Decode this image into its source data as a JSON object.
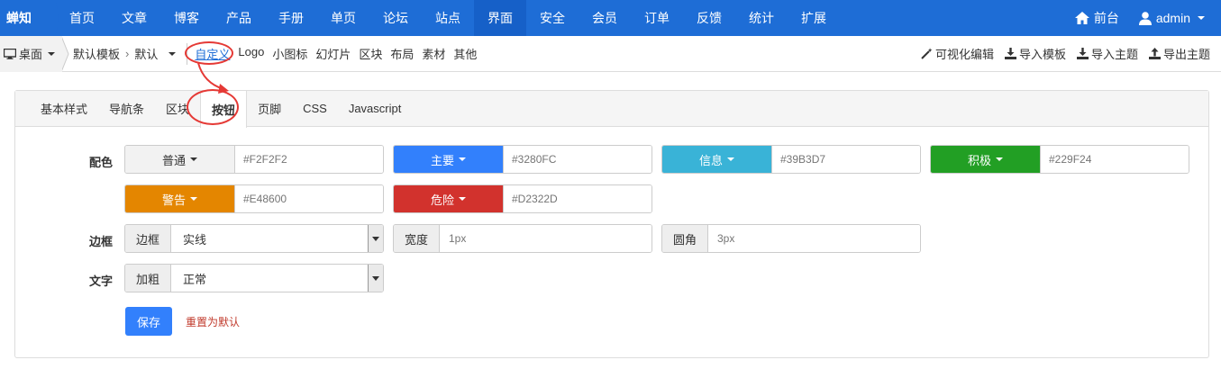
{
  "topnav": {
    "brand": "蝉知",
    "items": [
      "首页",
      "文章",
      "博客",
      "产品",
      "手册",
      "单页",
      "论坛",
      "站点",
      "界面",
      "安全",
      "会员",
      "订单",
      "反馈",
      "统计",
      "扩展"
    ],
    "active": "界面",
    "home": "前台",
    "user": "admin"
  },
  "subbar": {
    "desktop": "桌面",
    "crumb1": "默认模板",
    "crumb2": "默认",
    "links": [
      "自定义",
      "Logo",
      "小图标",
      "幻灯片",
      "区块",
      "布局",
      "素材",
      "其他"
    ],
    "active_link": "自定义",
    "right": [
      "可视化编辑",
      "导入模板",
      "导入主题",
      "导出主题"
    ]
  },
  "tabs": [
    "基本样式",
    "导航条",
    "区块",
    "按钮",
    "页脚",
    "CSS",
    "Javascript"
  ],
  "active_tab": "按钮",
  "form": {
    "color_label": "配色",
    "colors": [
      {
        "name": "普通",
        "placeholder": "#F2F2F2",
        "bg": "#f2f2f2",
        "fg": "#333333"
      },
      {
        "name": "主要",
        "placeholder": "#3280FC",
        "bg": "#3280fc",
        "fg": "#ffffff"
      },
      {
        "name": "信息",
        "placeholder": "#39B3D7",
        "bg": "#39b3d7",
        "fg": "#ffffff"
      },
      {
        "name": "积极",
        "placeholder": "#229F24",
        "bg": "#229f24",
        "fg": "#ffffff"
      },
      {
        "name": "警告",
        "placeholder": "#E48600",
        "bg": "#e48600",
        "fg": "#ffffff"
      },
      {
        "name": "危险",
        "placeholder": "#D2322D",
        "bg": "#d2322d",
        "fg": "#ffffff"
      }
    ],
    "border_label": "边框",
    "border_addon": "边框",
    "border_value": "实线",
    "width_addon": "宽度",
    "width_placeholder": "1px",
    "radius_addon": "圆角",
    "radius_placeholder": "3px",
    "text_label": "文字",
    "bold_addon": "加粗",
    "bold_value": "正常",
    "save": "保存",
    "reset": "重置为默认"
  }
}
